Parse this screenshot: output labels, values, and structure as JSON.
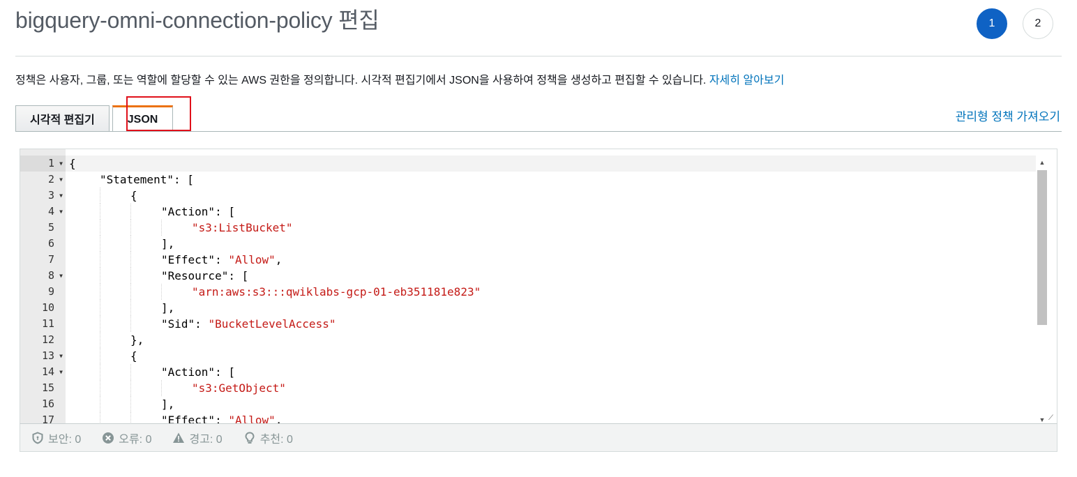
{
  "header": {
    "title": "bigquery-omni-connection-policy 편집",
    "steps": [
      "1",
      "2"
    ]
  },
  "description": {
    "text": "정책은 사용자, 그룹, 또는 역할에 할당할 수 있는 AWS 권한을 정의합니다. 시각적 편집기에서 JSON을 사용하여 정책을 생성하고 편집할 수 있습니다. ",
    "link": "자세히 알아보기"
  },
  "tabs": {
    "visual": "시각적 편집기",
    "json": "JSON",
    "import_link": "관리형 정책 가져오기"
  },
  "editor": {
    "line_numbers": [
      "1",
      "2",
      "3",
      "4",
      "5",
      "6",
      "7",
      "8",
      "9",
      "10",
      "11",
      "12",
      "13",
      "14",
      "15",
      "16",
      "17"
    ],
    "lines": [
      {
        "indent": 0,
        "parts": [
          [
            "p",
            "{"
          ]
        ]
      },
      {
        "indent": 1,
        "parts": [
          [
            "p",
            "\"Statement\": ["
          ]
        ]
      },
      {
        "indent": 2,
        "parts": [
          [
            "p",
            "{"
          ]
        ]
      },
      {
        "indent": 3,
        "parts": [
          [
            "p",
            "\"Action\": ["
          ]
        ]
      },
      {
        "indent": 4,
        "parts": [
          [
            "s",
            "\"s3:ListBucket\""
          ]
        ]
      },
      {
        "indent": 3,
        "parts": [
          [
            "p",
            "],"
          ]
        ]
      },
      {
        "indent": 3,
        "parts": [
          [
            "p",
            "\"Effect\": "
          ],
          [
            "s",
            "\"Allow\""
          ],
          [
            "p",
            ","
          ]
        ]
      },
      {
        "indent": 3,
        "parts": [
          [
            "p",
            "\"Resource\": ["
          ]
        ]
      },
      {
        "indent": 4,
        "parts": [
          [
            "s",
            "\"arn:aws:s3:::qwiklabs-gcp-01-eb351181e823\""
          ]
        ]
      },
      {
        "indent": 3,
        "parts": [
          [
            "p",
            "],"
          ]
        ]
      },
      {
        "indent": 3,
        "parts": [
          [
            "p",
            "\"Sid\": "
          ],
          [
            "s",
            "\"BucketLevelAccess\""
          ]
        ]
      },
      {
        "indent": 2,
        "parts": [
          [
            "p",
            "},"
          ]
        ]
      },
      {
        "indent": 2,
        "parts": [
          [
            "p",
            "{"
          ]
        ]
      },
      {
        "indent": 3,
        "parts": [
          [
            "p",
            "\"Action\": ["
          ]
        ]
      },
      {
        "indent": 4,
        "parts": [
          [
            "s",
            "\"s3:GetObject\""
          ]
        ]
      },
      {
        "indent": 3,
        "parts": [
          [
            "p",
            "],"
          ]
        ]
      },
      {
        "indent": 3,
        "parts": [
          [
            "p",
            "\"Effect\": "
          ],
          [
            "s",
            "\"Allow\""
          ],
          [
            "p",
            ","
          ]
        ]
      }
    ],
    "fold_lines": [
      1,
      2,
      3,
      4,
      8,
      13,
      14
    ],
    "active_line": 1
  },
  "status": {
    "security": "보안: 0",
    "errors": "오류: 0",
    "warnings": "경고: 0",
    "suggestions": "추천: 0"
  }
}
